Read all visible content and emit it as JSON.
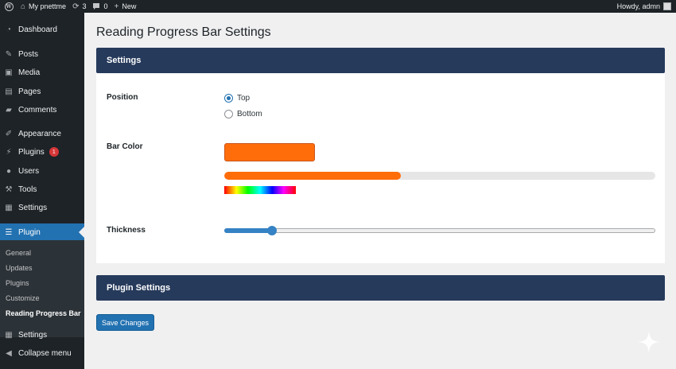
{
  "adminbar": {
    "site_name": "My pnettme",
    "updates_count": "3",
    "comments_count": "0",
    "new_label": "New",
    "greeting": "Howdy, admn"
  },
  "sidebar": {
    "items": [
      {
        "label": "Dashboard",
        "icon": "dashboard-icon"
      },
      {
        "label": "Posts",
        "icon": "pin-icon"
      },
      {
        "label": "Media",
        "icon": "media-icon"
      },
      {
        "label": "Pages",
        "icon": "page-icon"
      },
      {
        "label": "Comments",
        "icon": "comment-icon"
      },
      {
        "label": "Appearance",
        "icon": "brush-icon"
      },
      {
        "label": "Plugins",
        "icon": "plug-icon",
        "badge": "1"
      },
      {
        "label": "Users",
        "icon": "user-icon"
      },
      {
        "label": "Tools",
        "icon": "wrench-icon"
      },
      {
        "label": "Settings",
        "icon": "settings-icon"
      },
      {
        "label": "Plugin",
        "icon": "sliders-icon"
      },
      {
        "label": "Settings",
        "icon": "settings-icon"
      },
      {
        "label": "Collapse menu",
        "icon": "collapse-icon"
      }
    ],
    "submenu": [
      "General",
      "Updates",
      "Plugins",
      "Customize",
      "Reading Progress Bar"
    ]
  },
  "page": {
    "title": "Reading Progress Bar Settings",
    "settings_heading": "Settings",
    "plugin_settings_heading": "Plugin Settings",
    "save_label": "Save Changes"
  },
  "fields": {
    "position": {
      "label": "Position",
      "options": [
        "Top",
        "Bottom"
      ],
      "selected": "Top"
    },
    "bar_color": {
      "label": "Bar Color",
      "value": "#ff6d0a",
      "preview_fraction": 0.41
    },
    "thickness": {
      "label": "Thickness",
      "fraction": 0.11
    }
  },
  "colors": {
    "accent": "#2271b1",
    "header": "#263a5b",
    "sidebar": "#1d2327",
    "badge": "#d63638"
  }
}
